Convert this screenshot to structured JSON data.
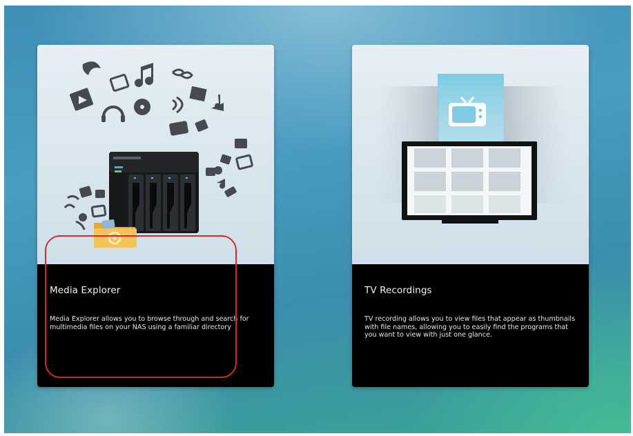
{
  "cards": [
    {
      "title": "Media Explorer",
      "description": "Media Explorer allows you to browse through and search for multimedia files on your NAS using a familiar directory",
      "icon": "nas-media-collage"
    },
    {
      "title": "TV Recordings",
      "description": "TV recording allows you to view files that appear as thumbnails with file names, allowing you to easily find the programs that you want to view with just one glance.",
      "icon": "tv-thumbnail-grid"
    }
  ],
  "colors": {
    "highlight": "#d22a2a",
    "info_panel": "#000000",
    "tv_accent": "#7fcbe3"
  }
}
